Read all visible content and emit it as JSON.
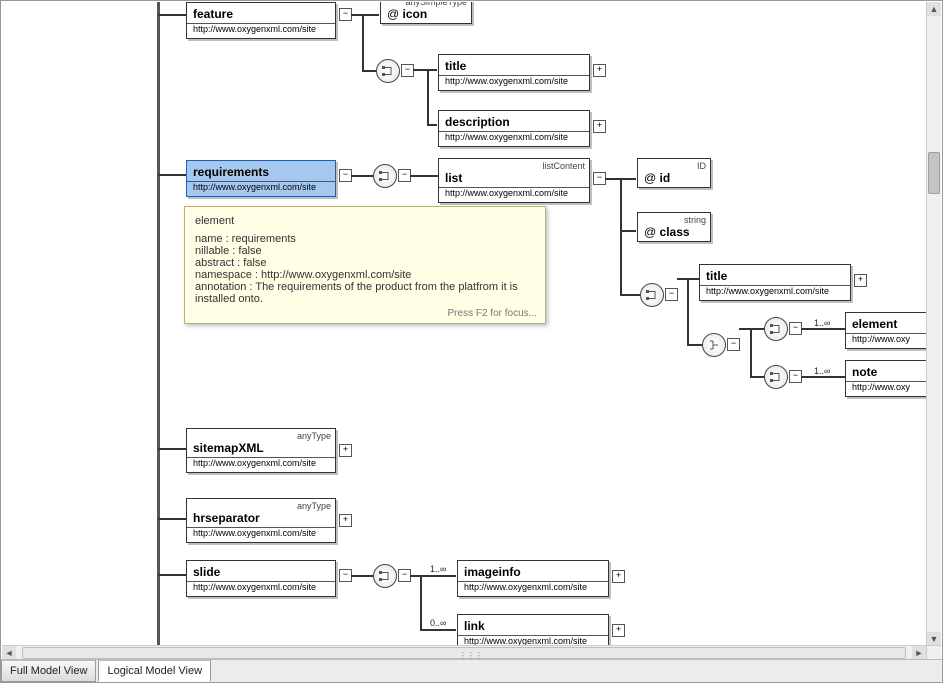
{
  "ns": "http://www.oxygenxml.com/site",
  "nsShort": "http://www.oxy",
  "tabs": {
    "full": "Full Model View",
    "logical": "Logical Model View"
  },
  "feature": {
    "label": "feature"
  },
  "icon": {
    "label": "icon",
    "type": "anySimpleType"
  },
  "title": {
    "label": "title"
  },
  "description": {
    "label": "description"
  },
  "requirements": {
    "label": "requirements"
  },
  "list": {
    "label": "list",
    "type": "listContent"
  },
  "id": {
    "label": "id",
    "type": "ID"
  },
  "class": {
    "label": "class",
    "type": "string"
  },
  "title2": {
    "label": "title"
  },
  "element": {
    "label": "element"
  },
  "note": {
    "label": "note"
  },
  "sitemapXML": {
    "label": "sitemapXML",
    "type": "anyType"
  },
  "hrseparator": {
    "label": "hrseparator",
    "type": "anyType"
  },
  "slide": {
    "label": "slide"
  },
  "imageinfo": {
    "label": "imageinfo"
  },
  "link": {
    "label": "link"
  },
  "card_1inf": "1..∞",
  "card_0inf": "0..∞",
  "tip": {
    "h": "element",
    "l1": "name : requirements",
    "l2": "nillable : false",
    "l3": "abstract : false",
    "l4": "namespace : http://www.oxygenxml.com/site",
    "l5": "annotation : The requirements of the product from the platfrom it is installed onto.",
    "ft": "Press F2 for focus..."
  }
}
